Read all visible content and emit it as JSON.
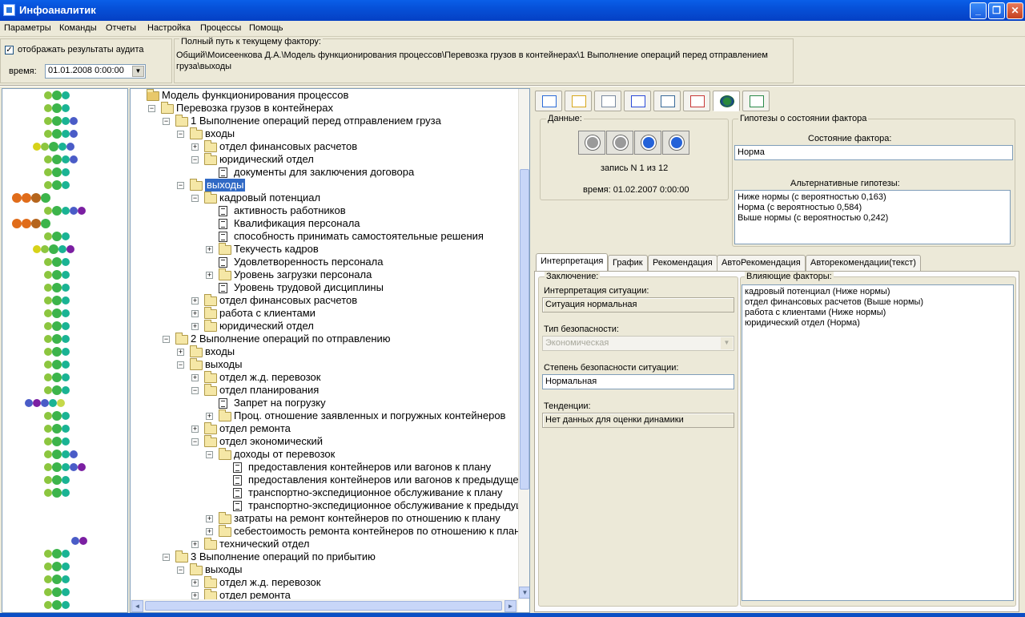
{
  "window": {
    "title": "Инфоаналитик",
    "min": "_",
    "max": "❐",
    "close": "✕"
  },
  "menu": [
    "Параметры",
    "Команды",
    "Отчеты",
    "Настройка",
    "Процессы",
    "Помощь"
  ],
  "audit": {
    "checkbox_label": "отображать результаты аудита",
    "checked": "✓",
    "time_label": "время:",
    "time_value": "01.01.2008   0:00:00"
  },
  "path": {
    "label": "Полный путь к текущему фактору:",
    "line1": "Общий\\Моисеенкова Д.А.\\Модель функционирования процессов\\Перевозка грузов в контейнерах\\1 Выполнение операций перед отправлением",
    "line2": "груза\\выходы"
  },
  "dot_colors": {
    "green": "#8cc63f",
    "dark_green": "#3cb44b",
    "teal": "#1ab394",
    "blue": "#4a5cc7",
    "purple": "#7b1fa2",
    "yellow": "#d7d219",
    "orange": "#e06c1a",
    "brown": "#b5651d",
    "lime": "#c6d94a"
  },
  "tree": [
    {
      "label": "Модель функционирования процессов",
      "level": 0,
      "icon": "root",
      "box": ""
    },
    {
      "label": "Перевозка грузов в контейнерах",
      "level": 1,
      "icon": "folder",
      "box": "−"
    },
    {
      "label": "1 Выполнение операций перед отправлением груза",
      "level": 2,
      "icon": "folder",
      "box": "−"
    },
    {
      "label": "входы",
      "level": 3,
      "icon": "folder",
      "box": "−"
    },
    {
      "label": "отдел финансовых расчетов",
      "level": 4,
      "icon": "folder",
      "box": "+"
    },
    {
      "label": "юридический отдел",
      "level": 4,
      "icon": "folder",
      "box": "−"
    },
    {
      "label": "документы для заключения договора",
      "level": 5,
      "icon": "doc",
      "box": ""
    },
    {
      "label": "выходы",
      "level": 3,
      "icon": "folder",
      "box": "−",
      "selected": true
    },
    {
      "label": "кадровый потенциал",
      "level": 4,
      "icon": "folder",
      "box": "−"
    },
    {
      "label": "активность работников",
      "level": 5,
      "icon": "doc",
      "box": ""
    },
    {
      "label": "Квалификация персонала",
      "level": 5,
      "icon": "doc",
      "box": ""
    },
    {
      "label": "способность принимать самостоятельные решения",
      "level": 5,
      "icon": "doc",
      "box": ""
    },
    {
      "label": "Текучесть кадров",
      "level": 5,
      "icon": "folder",
      "box": "+"
    },
    {
      "label": "Удовлетворенность персонала",
      "level": 5,
      "icon": "doc",
      "box": ""
    },
    {
      "label": "Уровень загрузки персонала",
      "level": 5,
      "icon": "folder",
      "box": "+"
    },
    {
      "label": "Уровень трудовой дисциплины",
      "level": 5,
      "icon": "doc",
      "box": ""
    },
    {
      "label": "отдел финансовых расчетов",
      "level": 4,
      "icon": "folder",
      "box": "+"
    },
    {
      "label": "работа с клиентами",
      "level": 4,
      "icon": "folder",
      "box": "+"
    },
    {
      "label": "юридический отдел",
      "level": 4,
      "icon": "folder",
      "box": "+"
    },
    {
      "label": "2 Выполнение операций по отправлению",
      "level": 2,
      "icon": "folder",
      "box": "−"
    },
    {
      "label": "входы",
      "level": 3,
      "icon": "folder",
      "box": "+"
    },
    {
      "label": "выходы",
      "level": 3,
      "icon": "folder",
      "box": "−"
    },
    {
      "label": "отдел ж.д. перевозок",
      "level": 4,
      "icon": "folder",
      "box": "+"
    },
    {
      "label": "отдел планирования",
      "level": 4,
      "icon": "folder",
      "box": "−"
    },
    {
      "label": "Запрет на погрузку",
      "level": 5,
      "icon": "doc",
      "box": ""
    },
    {
      "label": "Проц. отношение заявленных и погружных контейнеров",
      "level": 5,
      "icon": "folder",
      "box": "+"
    },
    {
      "label": "отдел ремонта",
      "level": 4,
      "icon": "folder",
      "box": "+"
    },
    {
      "label": "отдел экономический",
      "level": 4,
      "icon": "folder",
      "box": "−"
    },
    {
      "label": "доходы от перевозок",
      "level": 5,
      "icon": "folder",
      "box": "−"
    },
    {
      "label": "предоставления контейнеров или вагонов к плану",
      "level": 6,
      "icon": "doc",
      "box": ""
    },
    {
      "label": "предоставления контейнеров или вагонов к предыдущему",
      "level": 6,
      "icon": "doc",
      "box": ""
    },
    {
      "label": "транспортно-экспедиционное обслуживание к плану",
      "level": 6,
      "icon": "doc",
      "box": ""
    },
    {
      "label": "транспортно-экспедиционное обслуживание к предыдущему",
      "level": 6,
      "icon": "doc",
      "box": ""
    },
    {
      "label": "затраты на ремонт контейнеров по отношению к плану",
      "level": 5,
      "icon": "folder",
      "box": "+"
    },
    {
      "label": "себестоимость ремонта контейнеров по отношению к плану",
      "level": 5,
      "icon": "folder",
      "box": "+"
    },
    {
      "label": "технический отдел",
      "level": 4,
      "icon": "folder",
      "box": "+"
    },
    {
      "label": "3 Выполнение операций по прибытию",
      "level": 2,
      "icon": "folder",
      "box": "−"
    },
    {
      "label": "выходы",
      "level": 3,
      "icon": "folder",
      "box": "−"
    },
    {
      "label": "отдел ж.д. перевозок",
      "level": 4,
      "icon": "folder",
      "box": "+"
    },
    {
      "label": "отдел ремонта",
      "level": 4,
      "icon": "folder",
      "box": "+"
    }
  ],
  "toolbar_icons": [
    "structure-icon",
    "search-doc-icon",
    "edit-icon",
    "bar-chart-icon",
    "table-icon",
    "line-chart-icon",
    "globe-icon",
    "calculator-icon"
  ],
  "data_group": {
    "label": "Данные:",
    "record": "запись N 1 из 12",
    "time": "время: 01.02.2007 0:00:00"
  },
  "hypotheses": {
    "label": "Гипотезы о состоянии фактора",
    "state_label": "Состояние фактора:",
    "state_value": "Норма",
    "alt_label": "Альтернативные гипотезы:",
    "alt": [
      "Ниже нормы (с вероятностью 0,163)",
      "Норма (с вероятностью 0,584)",
      "Выше нормы (с вероятностью 0,242)"
    ]
  },
  "tabs": [
    "Интерпретация",
    "График",
    "Рекомендация",
    "АвтоРекомендация",
    "Авторекомендации(текст)"
  ],
  "conclusion": {
    "label": "Заключение:",
    "interp_label": "Интерпретация ситуации:",
    "interp_value": "Ситуация нормальная",
    "safety_type_label": "Тип безопасности:",
    "safety_type_value": "Экономическая",
    "safety_degree_label": "Степень безопасности ситуации:",
    "safety_degree_value": "Нормальная",
    "trend_label": "Тенденции:",
    "trend_value": "Нет данных для оценки динамики"
  },
  "factors": {
    "label": "Влияющие факторы:",
    "items": [
      "кадровый потенциал (Ниже нормы)",
      "отдел финансовых расчетов (Выше нормы)",
      "работа с клиентами (Ниже нормы)",
      "юридический отдел (Норма)"
    ]
  }
}
